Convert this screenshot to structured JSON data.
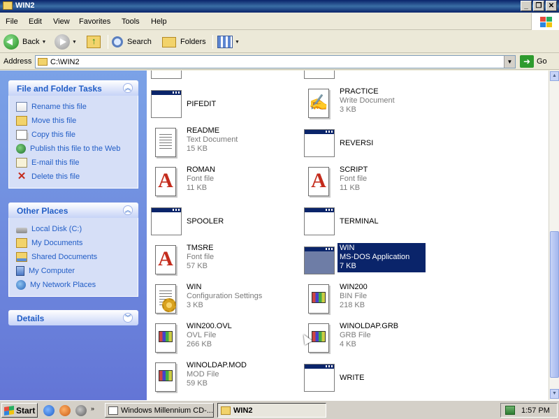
{
  "window": {
    "title": "WIN2"
  },
  "menu": [
    "File",
    "Edit",
    "View",
    "Favorites",
    "Tools",
    "Help"
  ],
  "toolbar": {
    "back_label": "Back",
    "search_label": "Search",
    "folders_label": "Folders"
  },
  "address": {
    "label": "Address",
    "value": "C:\\WIN2",
    "go_label": "Go"
  },
  "tasks": {
    "file_tasks": {
      "title": "File and Folder Tasks",
      "items": [
        "Rename this file",
        "Move this file",
        "Copy this file",
        "Publish this file to the Web",
        "E-mail this file",
        "Delete this file"
      ]
    },
    "other_places": {
      "title": "Other Places",
      "items": [
        "Local Disk (C:)",
        "My Documents",
        "Shared Documents",
        "My Computer",
        "My Network Places"
      ]
    },
    "details": {
      "title": "Details"
    }
  },
  "files": [
    {
      "name": "PIFEDIT",
      "type": "",
      "size": "",
      "icon": "app-window-icon"
    },
    {
      "name": "PRACTICE",
      "type": "Write Document",
      "size": "3 KB",
      "icon": "write-document-icon"
    },
    {
      "name": "README",
      "type": "Text Document",
      "size": "15 KB",
      "icon": "text-document-icon"
    },
    {
      "name": "REVERSI",
      "type": "",
      "size": "",
      "icon": "app-window-icon"
    },
    {
      "name": "ROMAN",
      "type": "Font file",
      "size": "11 KB",
      "icon": "font-file-icon"
    },
    {
      "name": "SCRIPT",
      "type": "Font file",
      "size": "11 KB",
      "icon": "font-file-icon"
    },
    {
      "name": "SPOOLER",
      "type": "",
      "size": "",
      "icon": "app-window-icon"
    },
    {
      "name": "TERMINAL",
      "type": "",
      "size": "",
      "icon": "app-window-icon"
    },
    {
      "name": "TMSRE",
      "type": "Font file",
      "size": "57 KB",
      "icon": "font-file-icon"
    },
    {
      "name": "WIN",
      "type": "MS-DOS Application",
      "size": "7 KB",
      "icon": "app-window-icon",
      "selected": true
    },
    {
      "name": "WIN",
      "type": "Configuration Settings",
      "size": "3 KB",
      "icon": "config-settings-icon"
    },
    {
      "name": "WIN200",
      "type": "BIN File",
      "size": "218 KB",
      "icon": "generic-file-icon"
    },
    {
      "name": "WIN200.OVL",
      "type": "OVL File",
      "size": "266 KB",
      "icon": "generic-file-icon"
    },
    {
      "name": "WINOLDAP.GRB",
      "type": "GRB File",
      "size": "4 KB",
      "icon": "generic-file-icon"
    },
    {
      "name": "WINOLDAP.MOD",
      "type": "MOD File",
      "size": "59 KB",
      "icon": "generic-file-icon"
    },
    {
      "name": "WRITE",
      "type": "",
      "size": "",
      "icon": "app-window-icon"
    }
  ],
  "taskbar": {
    "start_label": "Start",
    "buttons": [
      "Windows Millennium CD-...",
      "WIN2"
    ],
    "clock": "1:57 PM"
  },
  "colors": {
    "selection": "#0A246A",
    "task_link": "#215DC6",
    "taskpane_bg": "#6375D6"
  }
}
